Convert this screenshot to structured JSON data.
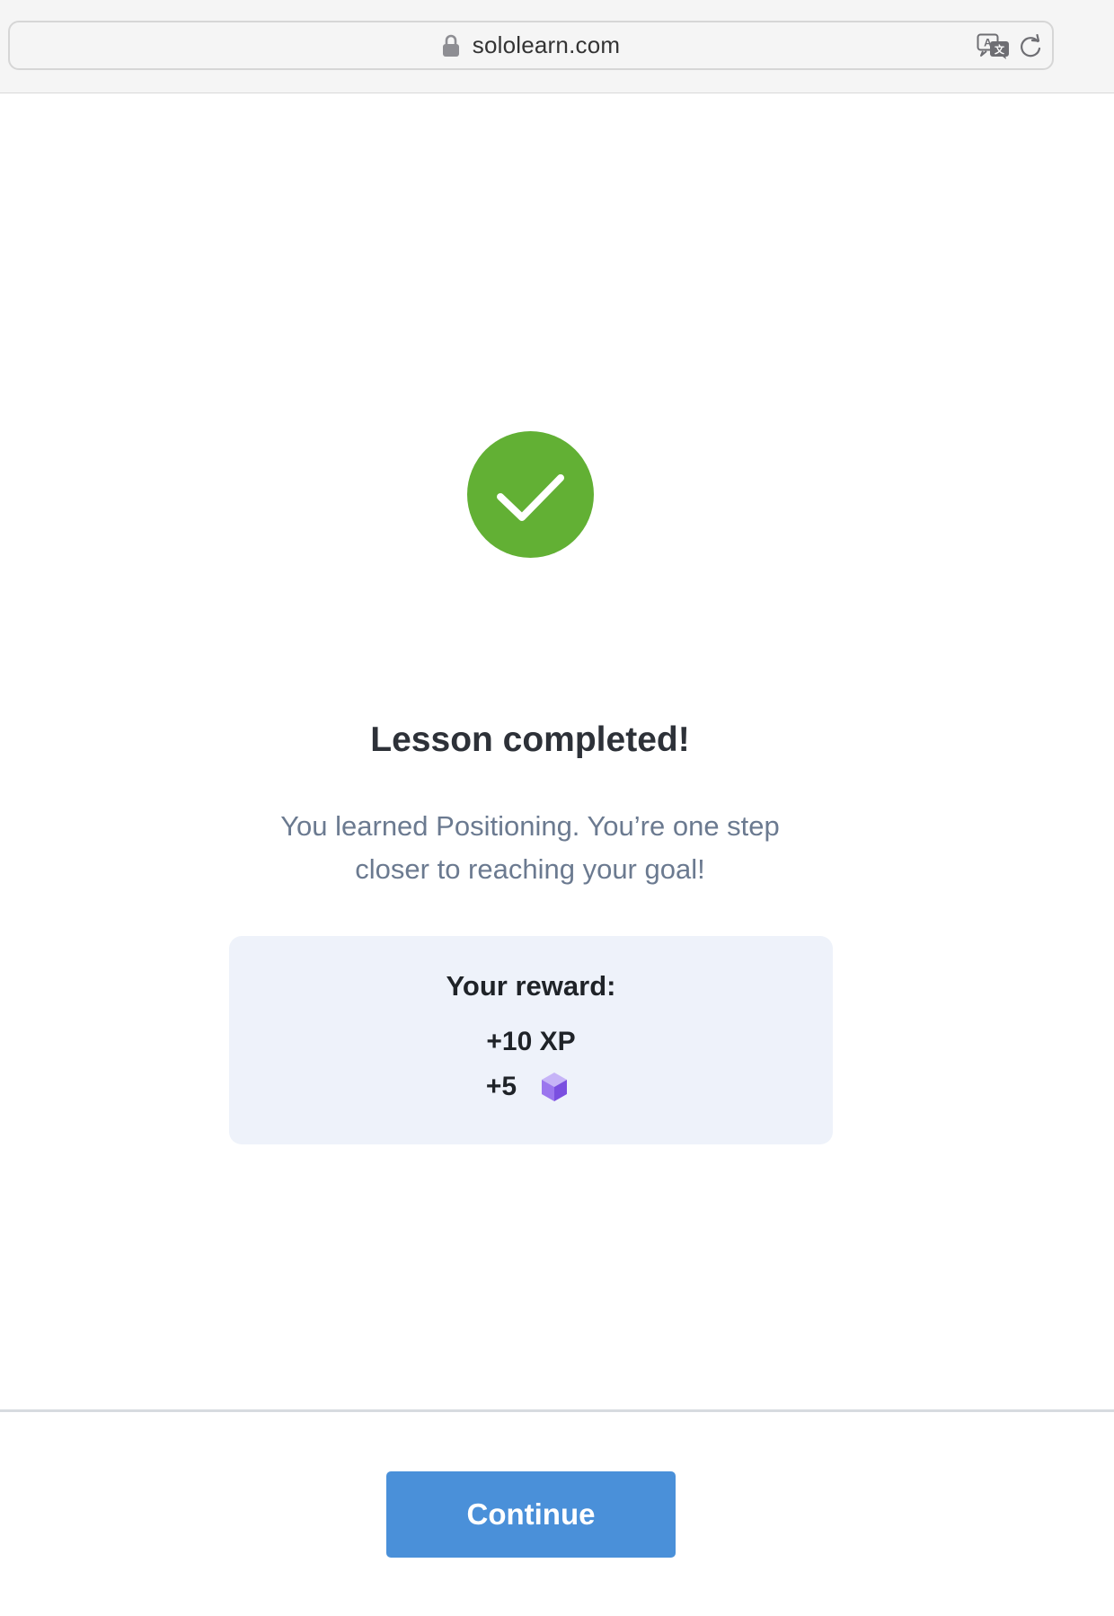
{
  "browser": {
    "url": "sololearn.com",
    "icons": {
      "lock": "lock-icon",
      "translate": "translate-icon",
      "reload": "reload-icon"
    }
  },
  "lesson": {
    "status_icon": "checkmark-circle-icon",
    "title": "Lesson completed!",
    "description": "You learned Positioning. You’re one step closer to reaching your goal!"
  },
  "reward": {
    "title": "Your reward:",
    "xp": "+10 XP",
    "gems": "+5",
    "gem_icon": "gem-cube-icon"
  },
  "footer": {
    "continue_label": "Continue"
  },
  "colors": {
    "success": "#62b034",
    "primary_button": "#4a90d9",
    "reward_card": "#eef2fa",
    "gem": "#8a63e6"
  }
}
